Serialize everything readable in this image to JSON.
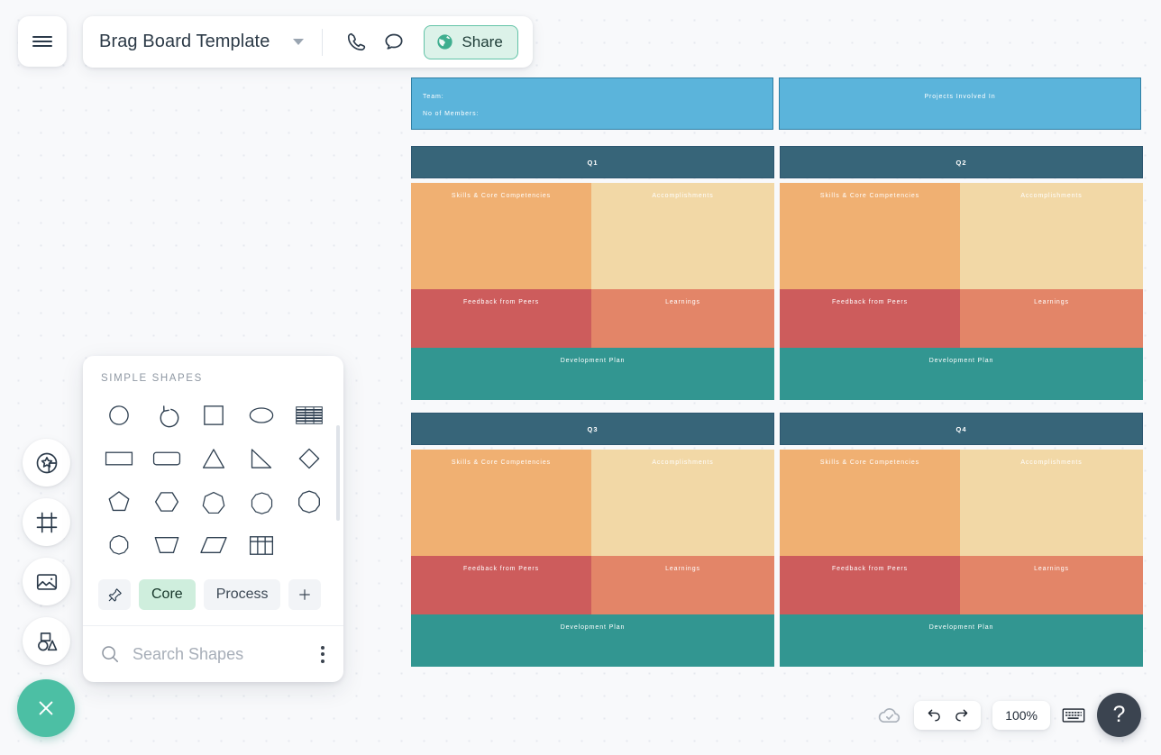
{
  "topbar": {
    "doc_title": "Brag Board Template",
    "caret_icon": "chevron-down-icon",
    "menu_icon": "hamburger-menu-icon",
    "call_icon": "phone-icon",
    "comment_icon": "chat-bubble-icon",
    "share_label": "Share",
    "share_icon": "globe-icon"
  },
  "rail": {
    "items": [
      {
        "icon": "sticker-star-icon",
        "name": "sidebar-item-stickers"
      },
      {
        "icon": "frame-icon",
        "name": "sidebar-item-frames"
      },
      {
        "icon": "image-icon",
        "name": "sidebar-item-images"
      },
      {
        "icon": "shapes-icon",
        "name": "sidebar-item-shapes"
      }
    ],
    "fab_icon": "close-icon"
  },
  "shapes_panel": {
    "heading": "SIMPLE SHAPES",
    "shapes": [
      "circle",
      "arc-arrow",
      "square",
      "ellipse",
      "table-striped",
      "rectangle",
      "rounded-rectangle",
      "triangle",
      "right-triangle",
      "diamond",
      "pentagon",
      "hexagon",
      "heptagon",
      "nonagon",
      "octagon",
      "decagon",
      "trapezoid",
      "parallelogram",
      "grid-table"
    ],
    "tabs": [
      {
        "label": "",
        "icon": "pin-icon",
        "active": false,
        "name": "tab-pinned"
      },
      {
        "label": "Core",
        "icon": "",
        "active": true,
        "name": "tab-core"
      },
      {
        "label": "Process",
        "icon": "",
        "active": false,
        "name": "tab-process"
      },
      {
        "label": "+",
        "icon": "plus-icon",
        "active": false,
        "name": "tab-add"
      }
    ],
    "search_placeholder": "Search Shapes",
    "search_icon": "search-icon",
    "more_icon": "kebab-menu-icon"
  },
  "board": {
    "header": {
      "left_lines": [
        "Team:",
        "No  of  Members:"
      ],
      "right_line": "Projects   Involved   In"
    },
    "quarters": [
      {
        "title": "Q1",
        "cells": {
          "skills": "Skills  &  Core   Competencies",
          "accomplishments": "Accomplishments",
          "feedback": "Feedback    from   Peers",
          "learnings": "Learnings",
          "development": "Development      Plan"
        }
      },
      {
        "title": "Q2",
        "cells": {
          "skills": "Skills  &  Core   Competencies",
          "accomplishments": "Accomplishments",
          "feedback": "Feedback    from   Peers",
          "learnings": "Learnings",
          "development": "Development      Plan"
        }
      },
      {
        "title": "Q3",
        "cells": {
          "skills": "Skills  &  Core   Competencies",
          "accomplishments": "Accomplishments",
          "feedback": "Feedback    from   Peers",
          "learnings": "Learnings",
          "development": "Development      Plan"
        }
      },
      {
        "title": "Q4",
        "cells": {
          "skills": "Skills  &  Core   Competencies",
          "accomplishments": "Accomplishments",
          "feedback": "Feedback    from   Peers",
          "learnings": "Learnings",
          "development": "Development      Plan"
        }
      }
    ],
    "colors": {
      "header_blue": "#5bb4db",
      "header_blue_border": "#2f7fa4",
      "quarter_bar": "#376579",
      "quarter_bar_border": "#2d5770",
      "skills_orange": "#f0b072",
      "accomplishments_tan": "#f2d8a6",
      "feedback_red": "#cd5c5c",
      "learnings_salmon": "#e38568",
      "development_teal": "#329691"
    }
  },
  "bottombar": {
    "save_icon": "cloud-check-icon",
    "undo_icon": "undo-icon",
    "redo_icon": "redo-icon",
    "zoom_level": "100%",
    "keyboard_icon": "keyboard-icon",
    "help_label": "?"
  },
  "theme": {
    "canvas_bg": "#f8f9fb",
    "accent_teal": "#4cbfa4",
    "share_mint": "#dcf2e9"
  }
}
